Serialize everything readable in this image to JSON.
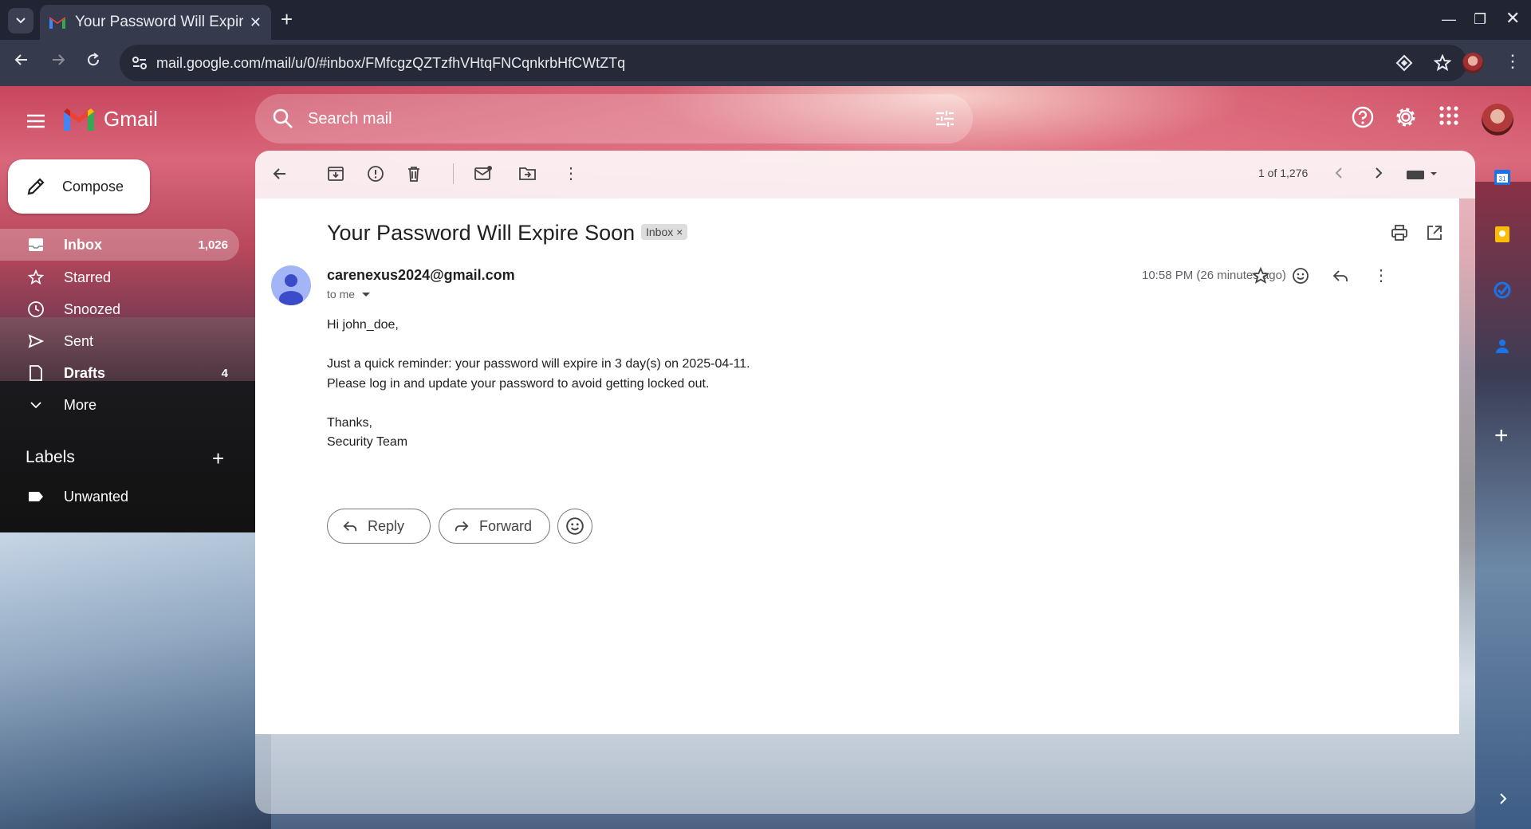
{
  "browser": {
    "tab_title": "Your Password Will Expire Soon",
    "url": "mail.google.com/mail/u/0/#inbox/FMfcgzQZTzfhVHtqFNCqnkrbHfCWtZTq"
  },
  "gmail": {
    "logo_text": "Gmail",
    "search_placeholder": "Search mail",
    "compose_label": "Compose",
    "nav": [
      {
        "label": "Inbox",
        "count": "1,026"
      },
      {
        "label": "Starred",
        "count": ""
      },
      {
        "label": "Snoozed",
        "count": ""
      },
      {
        "label": "Sent",
        "count": ""
      },
      {
        "label": "Drafts",
        "count": "4"
      },
      {
        "label": "More",
        "count": ""
      }
    ],
    "labels_heading": "Labels",
    "labels": [
      {
        "label": "Unwanted"
      }
    ]
  },
  "toolbar": {
    "pager_text": "1 of 1,276"
  },
  "email": {
    "subject": "Your Password Will Expire Soon",
    "chip": "Inbox",
    "sender": "carenexus2024@gmail.com",
    "to": "to me",
    "time": "10:58 PM (26 minutes ago)",
    "body": {
      "greeting": "Hi john_doe,",
      "line1": "Just a quick reminder: your password will expire in 3 day(s) on 2025-04-11.",
      "line2": "Please log in and update your password to avoid getting locked out.",
      "closing": "Thanks,",
      "signature": "Security Team"
    },
    "reply_label": "Reply",
    "forward_label": "Forward"
  },
  "colors": {
    "accent": "#c5221f",
    "sender_avatar": "#a3b5f7"
  }
}
